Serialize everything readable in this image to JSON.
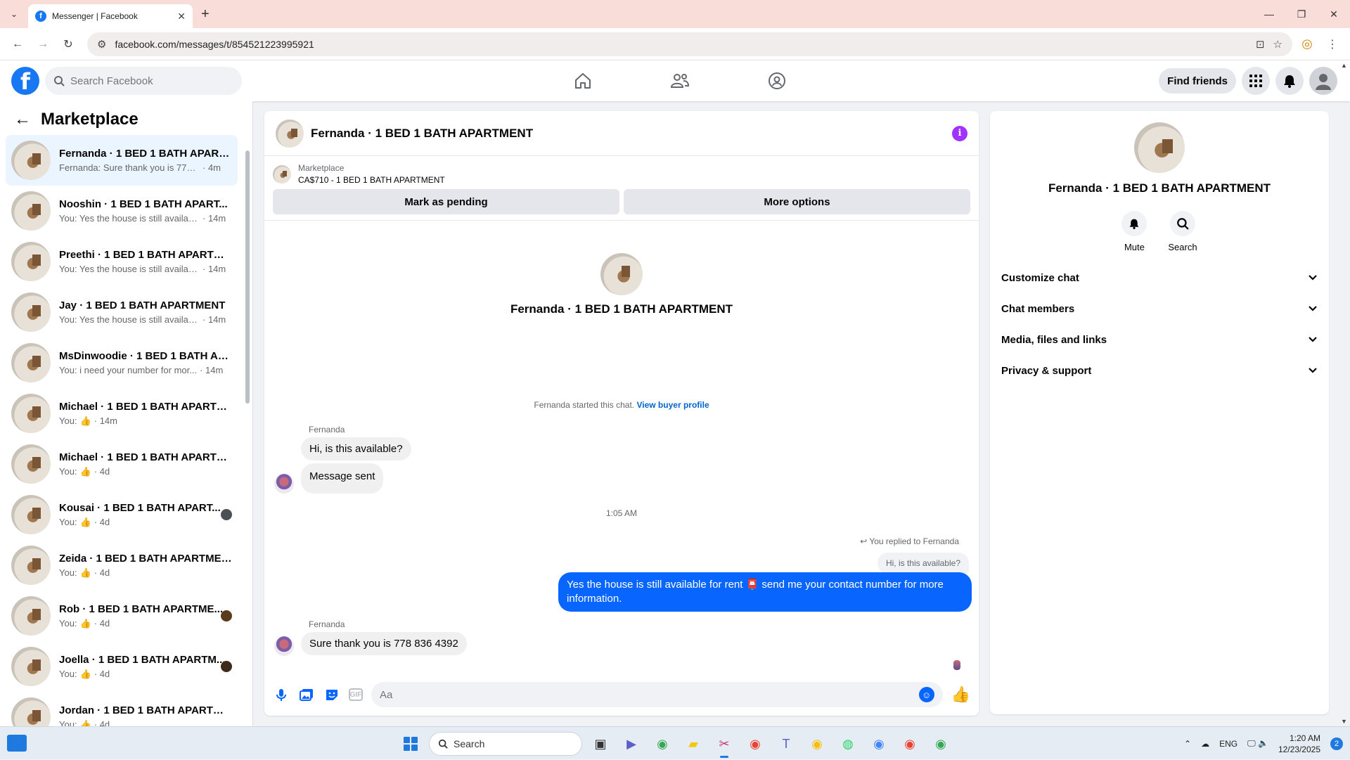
{
  "browser": {
    "tab_title": "Messenger | Facebook",
    "url": "facebook.com/messages/t/854521223995921"
  },
  "header": {
    "search_placeholder": "Search Facebook",
    "find_friends": "Find friends"
  },
  "sidebar": {
    "title": "Marketplace",
    "conversations": [
      {
        "name": "Fernanda · 1 BED 1 BATH APART...",
        "snippet": "Fernanda: Sure thank you is 778 8...",
        "time": "· 4m",
        "like": false,
        "active": true
      },
      {
        "name": "Nooshin · 1 BED 1 BATH APART...",
        "snippet": "You: Yes the house is still availabl...",
        "time": "· 14m",
        "like": false
      },
      {
        "name": "Preethi · 1 BED 1 BATH APARTME...",
        "snippet": "You: Yes the house is still availabl...",
        "time": "· 14m",
        "like": false
      },
      {
        "name": "Jay · 1 BED 1 BATH APARTMENT",
        "snippet": "You: Yes the house is still availabl...",
        "time": "· 14m",
        "like": false
      },
      {
        "name": "MsDinwoodie · 1 BED 1 BATH AP...",
        "snippet": "You: i need your number for mor...",
        "time": "· 14m",
        "like": false
      },
      {
        "name": "Michael · 1 BED 1 BATH APARTM...",
        "snippet": "You:",
        "time": "· 14m",
        "like": true
      },
      {
        "name": "Michael · 1 BED 1 BATH APARTM...",
        "snippet": "You:",
        "time": "· 4d",
        "like": true
      },
      {
        "name": "Kousai · 1 BED 1 BATH APART...",
        "snippet": "You:",
        "time": "· 4d",
        "like": true,
        "seen": "#4b4f56"
      },
      {
        "name": "Zeida · 1 BED 1 BATH APARTMENT",
        "snippet": "You:",
        "time": "· 4d",
        "like": true
      },
      {
        "name": "Rob · 1 BED 1 BATH APARTME...",
        "snippet": "You:",
        "time": "· 4d",
        "like": true,
        "seen": "#5a3b1e"
      },
      {
        "name": "Joella · 1 BED 1 BATH APARTM...",
        "snippet": "You:",
        "time": "· 4d",
        "like": true,
        "seen": "#3e2a1a"
      },
      {
        "name": "Jordan · 1 BED 1 BATH APARTME...",
        "snippet": "You:",
        "time": "· 4d",
        "like": true
      }
    ]
  },
  "chat": {
    "title": "Fernanda · 1 BED 1 BATH APARTMENT",
    "listing_source": "Marketplace",
    "listing_title": "CA$710 - 1 BED 1 BATH APARTMENT",
    "mark_pending": "Mark as pending",
    "more_options": "More options",
    "intro_name": "Fernanda · 1 BED 1 BATH APARTMENT",
    "started_text": "Fernanda started this chat.",
    "view_profile": "View buyer profile",
    "sender": "Fernanda",
    "msg1": "Hi, is this available?",
    "msg2": "Message sent",
    "timestamp": "1:05 AM",
    "replied_label": "You replied to Fernanda",
    "quoted": "Hi, is this available?",
    "reply": "Yes the house is still available for rent 📮 send me your contact number for more information.",
    "sender2": "Fernanda",
    "msg3": "Sure thank you is 778 836 4392",
    "composer_placeholder": "Aa"
  },
  "info_panel": {
    "name": "Fernanda · 1 BED 1 BATH APARTMENT",
    "mute": "Mute",
    "search": "Search",
    "sections": [
      "Customize chat",
      "Chat members",
      "Media, files and links",
      "Privacy & support"
    ]
  },
  "taskbar": {
    "search_label": "Search",
    "lang": "ENG",
    "time": "1:20 AM",
    "date": "12/23/2025",
    "notifications": "2"
  },
  "colors": {
    "fb_blue": "#1877f2",
    "messenger_blue": "#0866ff",
    "info_purple": "#a033ff"
  }
}
